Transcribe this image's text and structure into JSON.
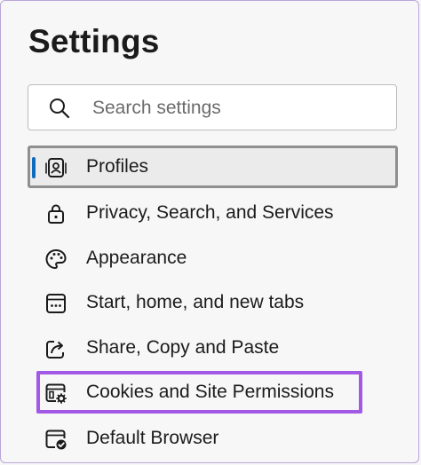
{
  "page": {
    "title": "Settings"
  },
  "search": {
    "placeholder": "Search settings",
    "icon": "search-icon"
  },
  "nav": {
    "items": [
      {
        "label": "Profiles",
        "icon": "profile-icon",
        "selected": true
      },
      {
        "label": "Privacy, Search, and Services",
        "icon": "lock-icon"
      },
      {
        "label": "Appearance",
        "icon": "palette-icon"
      },
      {
        "label": "Start, home, and new tabs",
        "icon": "start-page-icon"
      },
      {
        "label": "Share, Copy and Paste",
        "icon": "share-icon"
      },
      {
        "label": "Cookies and Site Permissions",
        "icon": "site-permissions-icon",
        "highlighted": true
      },
      {
        "label": "Default Browser",
        "icon": "default-browser-icon"
      }
    ]
  },
  "colors": {
    "accent": "#0f6cbd",
    "highlight": "#a259e6",
    "selected_border": "#8f8f8f",
    "frame_border": "#b9a6d9"
  }
}
